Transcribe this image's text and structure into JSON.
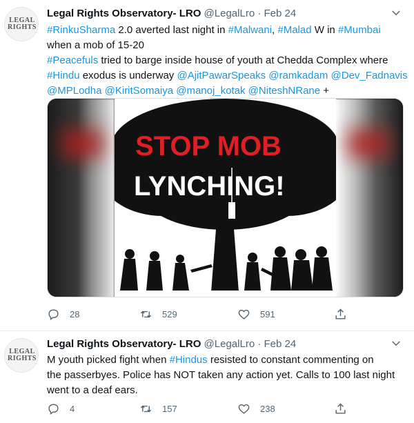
{
  "tweets": [
    {
      "author": {
        "name": "Legal Rights Observatory- LRO",
        "handle": "@LegalLro",
        "separator": "·",
        "date": "Feb 24",
        "avatar_text_line1": "LEGAL",
        "avatar_text_line2": "RIGHTS"
      },
      "lines": [
        [
          {
            "t": "#RinkuSharma",
            "tag": true
          },
          {
            "t": " 2.0 averted last night in "
          },
          {
            "t": "#Malwani",
            "tag": true
          },
          {
            "t": ", "
          },
          {
            "t": "#Malad",
            "tag": true
          },
          {
            "t": " W in "
          },
          {
            "t": "#Mumbai",
            "tag": true
          }
        ],
        [
          {
            "t": "when a mob of 15-20"
          }
        ],
        [
          {
            "t": "#Peacefuls",
            "tag": true
          },
          {
            "t": " tried to barge inside house of youth at Chedda Complex where"
          }
        ],
        [
          {
            "t": "#Hindu",
            "tag": true
          },
          {
            "t": " exodus is underway "
          },
          {
            "t": "@AjitPawarSpeaks",
            "tag": true
          },
          {
            "t": " "
          },
          {
            "t": "@ramkadam",
            "tag": true
          },
          {
            "t": " "
          },
          {
            "t": "@Dev_Fadnavis",
            "tag": true
          }
        ],
        [
          {
            "t": "@MPLodha",
            "tag": true
          },
          {
            "t": " "
          },
          {
            "t": "@KiritSomaiya",
            "tag": true
          },
          {
            "t": " "
          },
          {
            "t": "@manoj_kotak",
            "tag": true
          },
          {
            "t": " "
          },
          {
            "t": "@NiteshNRane",
            "tag": true
          },
          {
            "t": " +"
          }
        ]
      ],
      "media": {
        "headline_line1": "STOP MOB",
        "headline_line2": "LYNCHING!"
      },
      "actions": {
        "replies": "28",
        "retweets": "529",
        "likes": "591"
      }
    },
    {
      "author": {
        "name": "Legal Rights Observatory- LRO",
        "handle": "@LegalLro",
        "separator": "·",
        "date": "Feb 24",
        "avatar_text_line1": "LEGAL",
        "avatar_text_line2": "RIGHTS"
      },
      "lines": [
        [
          {
            "t": "M youth picked fight when "
          },
          {
            "t": "#Hindus",
            "tag": true
          },
          {
            "t": " resisted to constant commenting on"
          }
        ],
        [
          {
            "t": "the passerbyes. Police has NOT taken any action yet. Calls to 100 last night"
          }
        ],
        [
          {
            "t": "went to a deaf ears."
          }
        ]
      ],
      "actions": {
        "replies": "4",
        "retweets": "157",
        "likes": "238"
      }
    }
  ],
  "colors": {
    "link": "#1b95e0",
    "text": "#0f1419",
    "muted": "#536471",
    "poster_red": "#e01e25"
  },
  "icons": [
    "more-icon",
    "reply-icon",
    "retweet-icon",
    "like-icon",
    "share-icon"
  ]
}
